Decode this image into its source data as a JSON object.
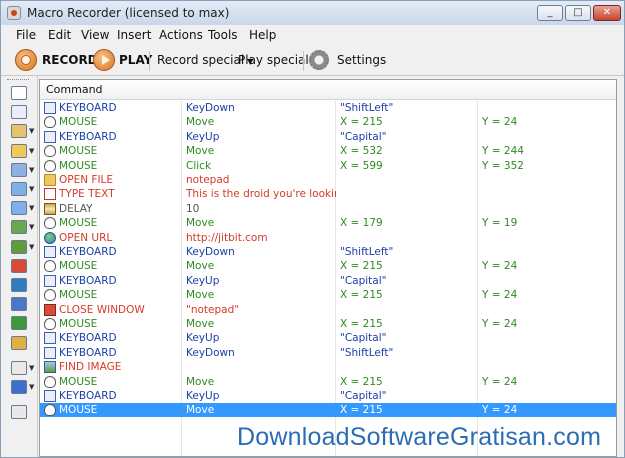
{
  "window": {
    "title": "Macro Recorder (licensed to max)"
  },
  "menu": [
    "File",
    "Edit",
    "View",
    "Insert",
    "Actions",
    "Tools",
    "Help"
  ],
  "toolbar": {
    "record_label": "RECORD",
    "play_label": "PLAY",
    "record_special_label": "Record special",
    "play_special_label": "Play special",
    "settings_label": "Settings"
  },
  "sidebar_icons": [
    "mouse-icon",
    "keyboard-icon",
    "delay-icon",
    "open-file-icon",
    "window-icon",
    "image-icon",
    "variable-icon",
    "eyedropper-icon",
    "screenshot-icon",
    "stop-icon",
    "globe-icon",
    "info-icon",
    "internet-icon",
    "run-icon",
    "if-icon",
    "repeat-icon",
    "text-icon"
  ],
  "grid": {
    "header": "Command",
    "colors": {
      "keyboard": "#1a3fa8",
      "mouse": "#2e8b20",
      "red": "#d43a2a",
      "delay": "#555555",
      "selected_bg": "#3399ff"
    },
    "rows": [
      {
        "type": "keyboard",
        "icon": "keyboard-icon",
        "command": "KEYBOARD",
        "action": "KeyDown",
        "p1": "\"ShiftLeft\"",
        "p2": ""
      },
      {
        "type": "mouse",
        "icon": "mouse-icon",
        "command": "MOUSE",
        "action": "Move",
        "p1": "X = 215",
        "p2": "Y = 24"
      },
      {
        "type": "keyboard",
        "icon": "keyboard-icon",
        "command": "KEYBOARD",
        "action": "KeyUp",
        "p1": "\"Capital\"",
        "p2": ""
      },
      {
        "type": "mouse",
        "icon": "mouse-icon",
        "command": "MOUSE",
        "action": "Move",
        "p1": "X = 532",
        "p2": "Y = 244"
      },
      {
        "type": "mouse",
        "icon": "mouse-icon",
        "command": "MOUSE",
        "action": "Click",
        "p1": "X = 599",
        "p2": "Y = 352"
      },
      {
        "type": "red",
        "icon": "folder-icon",
        "command": "OPEN FILE",
        "action": "notepad",
        "p1": "",
        "p2": ""
      },
      {
        "type": "red",
        "icon": "text-icon",
        "command": "TYPE TEXT",
        "action": "This is the droid you're looking for!",
        "p1": "",
        "p2": ""
      },
      {
        "type": "delay",
        "icon": "hourglass-icon",
        "command": "DELAY",
        "action": "10",
        "p1": "",
        "p2": ""
      },
      {
        "type": "mouse",
        "icon": "mouse-icon",
        "command": "MOUSE",
        "action": "Move",
        "p1": "X = 179",
        "p2": "Y = 19"
      },
      {
        "type": "red",
        "icon": "globe-icon",
        "command": "OPEN URL",
        "action": "http://jitbit.com",
        "p1": "",
        "p2": ""
      },
      {
        "type": "keyboard",
        "icon": "keyboard-icon",
        "command": "KEYBOARD",
        "action": "KeyDown",
        "p1": "\"ShiftLeft\"",
        "p2": ""
      },
      {
        "type": "mouse",
        "icon": "mouse-icon",
        "command": "MOUSE",
        "action": "Move",
        "p1": "X = 215",
        "p2": "Y = 24"
      },
      {
        "type": "keyboard",
        "icon": "keyboard-icon",
        "command": "KEYBOARD",
        "action": "KeyUp",
        "p1": "\"Capital\"",
        "p2": ""
      },
      {
        "type": "mouse",
        "icon": "mouse-icon",
        "command": "MOUSE",
        "action": "Move",
        "p1": "X = 215",
        "p2": "Y = 24"
      },
      {
        "type": "red",
        "icon": "close-window-icon",
        "command": "CLOSE WINDOW",
        "action": "\"notepad\"",
        "p1": "",
        "p2": ""
      },
      {
        "type": "mouse",
        "icon": "mouse-icon",
        "command": "MOUSE",
        "action": "Move",
        "p1": "X = 215",
        "p2": "Y = 24"
      },
      {
        "type": "keyboard",
        "icon": "keyboard-icon",
        "command": "KEYBOARD",
        "action": "KeyUp",
        "p1": "\"Capital\"",
        "p2": ""
      },
      {
        "type": "keyboard",
        "icon": "keyboard-icon",
        "command": "KEYBOARD",
        "action": "KeyDown",
        "p1": "\"ShiftLeft\"",
        "p2": ""
      },
      {
        "type": "red",
        "icon": "image-icon",
        "command": "FIND IMAGE",
        "action": "",
        "p1": "",
        "p2": ""
      },
      {
        "type": "mouse",
        "icon": "mouse-icon",
        "command": "MOUSE",
        "action": "Move",
        "p1": "X = 215",
        "p2": "Y = 24"
      },
      {
        "type": "keyboard",
        "icon": "keyboard-icon",
        "command": "KEYBOARD",
        "action": "KeyUp",
        "p1": "\"Capital\"",
        "p2": ""
      },
      {
        "type": "mouse",
        "icon": "mouse-icon",
        "command": "MOUSE",
        "action": "Move",
        "p1": "X = 215",
        "p2": "Y = 24",
        "selected": true
      }
    ]
  },
  "watermark": "DownloadSoftwareGratisan.com"
}
